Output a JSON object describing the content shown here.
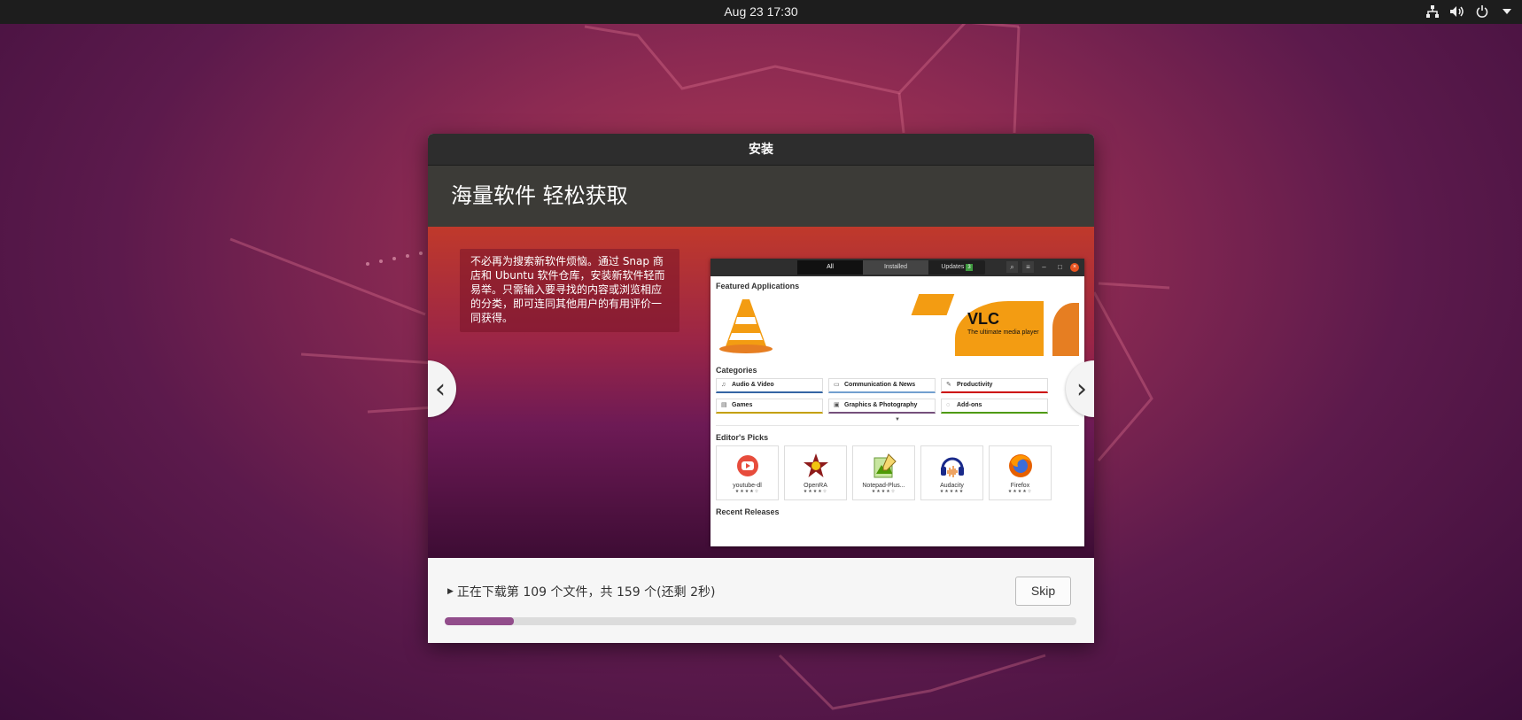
{
  "topbar": {
    "clock": "Aug 23  17:30",
    "tray_icons": [
      "network-icon",
      "volume-icon",
      "power-icon",
      "menu-arrow-icon"
    ]
  },
  "window": {
    "title": "安装",
    "header": "海量软件 轻松获取",
    "slide": {
      "description": "不必再为搜索新软件烦恼。通过 Snap 商店和 Ubuntu 软件仓库，安装新软件轻而易举。只需输入要寻找的内容或浏览相应的分类，即可连同其他用户的有用评价一同获得。",
      "prev_icon": "‹",
      "next_icon": "›"
    },
    "mock": {
      "tabs": [
        "All",
        "Installed",
        "Updates"
      ],
      "updates_count": "3",
      "featured_title": "Featured Applications",
      "banner_title": "VLC",
      "banner_subtitle": "The ultimate media player",
      "categories_title": "Categories",
      "categories": [
        {
          "label": "Audio & Video",
          "icon": "♫",
          "color": "#3465a4"
        },
        {
          "label": "Communication & News",
          "icon": "▭",
          "color": "#729fcf"
        },
        {
          "label": "Productivity",
          "icon": "✎",
          "color": "#cc0000"
        },
        {
          "label": "Games",
          "icon": "▤",
          "color": "#c4a000"
        },
        {
          "label": "Graphics & Photography",
          "icon": "▣",
          "color": "#75507b"
        },
        {
          "label": "Add-ons",
          "icon": "◌",
          "color": "#4e9a06"
        }
      ],
      "editors_title": "Editor's Picks",
      "picks": [
        {
          "name": "youtube-dl",
          "stars": "★★★★☆"
        },
        {
          "name": "OpenRA",
          "stars": "★★★★☆"
        },
        {
          "name": "Notepad-Plus...",
          "stars": "★★★★☆"
        },
        {
          "name": "Audacity",
          "stars": "★★★★★"
        },
        {
          "name": "Firefox",
          "stars": "★★★★☆"
        }
      ],
      "recent_title": "Recent Releases"
    },
    "footer": {
      "status": "正在下载第 109 个文件，共 159 个(还剩 2秒)",
      "skip_label": "Skip",
      "progress_fraction": 0.11
    }
  }
}
